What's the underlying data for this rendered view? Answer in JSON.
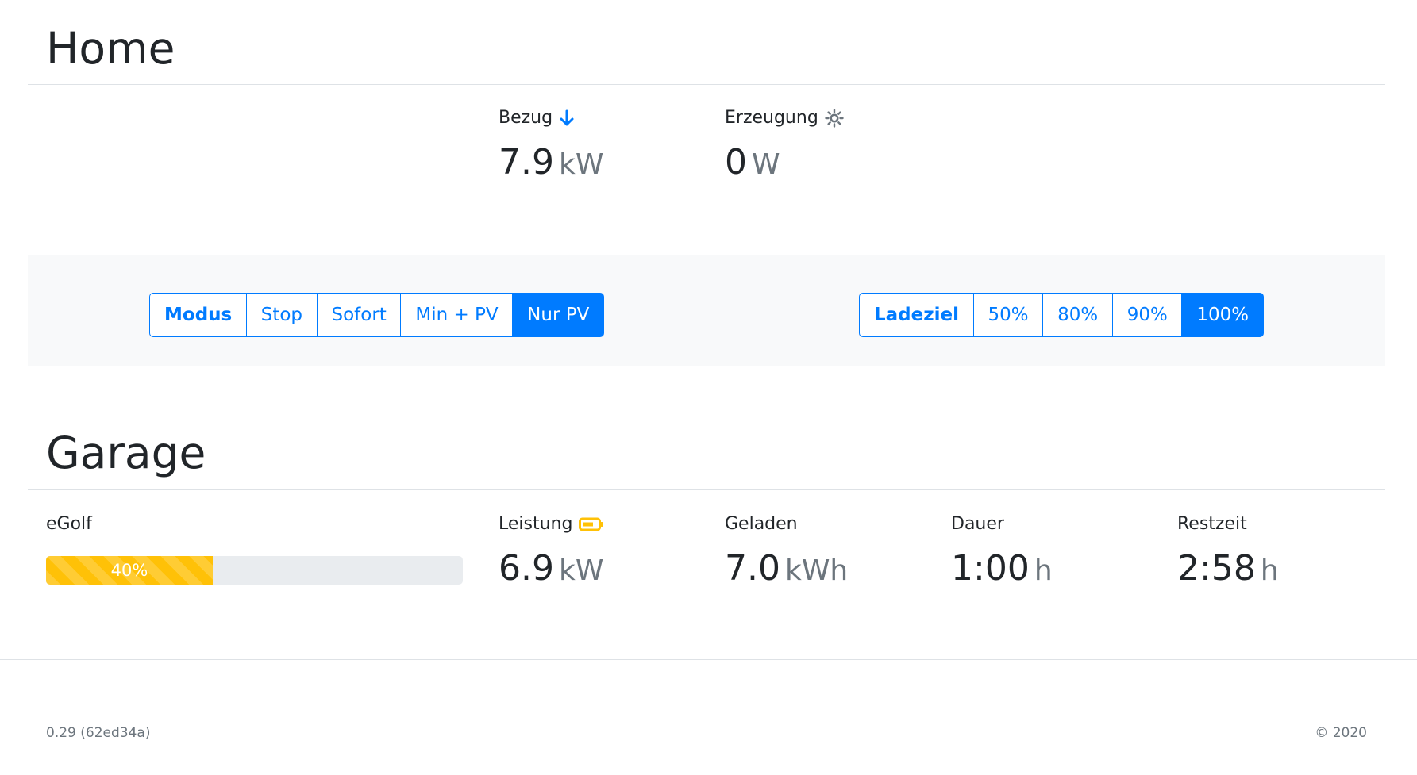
{
  "home": {
    "title": "Home",
    "bezug": {
      "label": "Bezug",
      "value": "7.9",
      "unit": "kW",
      "icon": "arrow-down-icon"
    },
    "erzeugung": {
      "label": "Erzeugung",
      "value": "0",
      "unit": "W",
      "icon": "sun-icon"
    }
  },
  "modus": {
    "label": "Modus",
    "options": [
      "Stop",
      "Sofort",
      "Min + PV",
      "Nur PV"
    ],
    "selected": "Nur PV"
  },
  "ladeziel": {
    "label": "Ladeziel",
    "options": [
      "50%",
      "80%",
      "90%",
      "100%"
    ],
    "selected": "100%"
  },
  "garage": {
    "title": "Garage",
    "vehicle": {
      "name": "eGolf",
      "soc_label": "40%",
      "soc_percent": 40
    },
    "leistung": {
      "label": "Leistung",
      "value": "6.9",
      "unit": "kW",
      "icon": "battery-charging-icon"
    },
    "geladen": {
      "label": "Geladen",
      "value": "7.0",
      "unit": "kWh"
    },
    "dauer": {
      "label": "Dauer",
      "value": "1:00",
      "unit": "h"
    },
    "restzeit": {
      "label": "Restzeit",
      "value": "2:58",
      "unit": "h"
    }
  },
  "footer": {
    "version": "0.29 (62ed34a)",
    "copyright": "© 2020"
  },
  "colors": {
    "primary": "#007bff",
    "warning": "#ffc107",
    "muted": "#6c757d",
    "band": "#f8f9fa"
  }
}
